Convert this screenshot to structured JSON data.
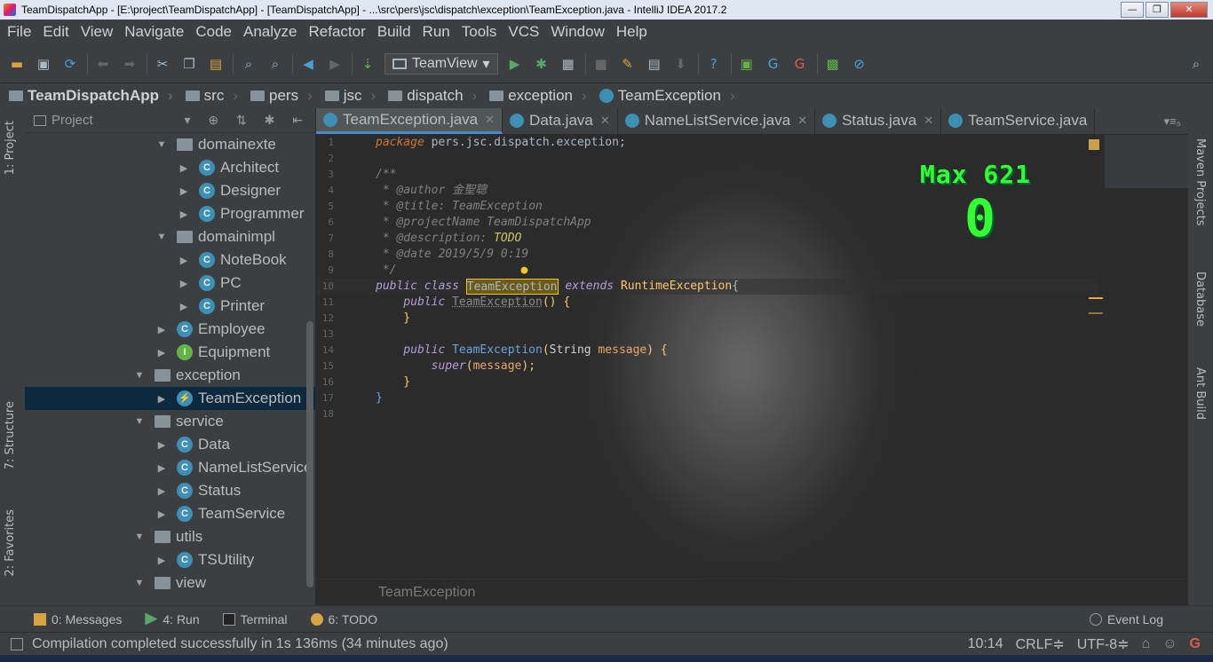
{
  "window": {
    "title": "TeamDispatchApp - [E:\\project\\TeamDispatchApp] - [TeamDispatchApp] - ...\\src\\pers\\jsc\\dispatch\\exception\\TeamException.java - IntelliJ IDEA 2017.2",
    "minimize": "—",
    "maximize": "❐",
    "close": "✕"
  },
  "menu": [
    "File",
    "Edit",
    "View",
    "Navigate",
    "Code",
    "Analyze",
    "Refactor",
    "Build",
    "Run",
    "Tools",
    "VCS",
    "Window",
    "Help"
  ],
  "toolbar": {
    "run_config": "TeamView",
    "run_config_arrow": "▾"
  },
  "breadcrumb": {
    "project": "TeamDispatchApp",
    "items": [
      "src",
      "pers",
      "jsc",
      "dispatch",
      "exception"
    ],
    "current": "TeamException"
  },
  "side_tabs": {
    "project": "1: Project",
    "structure": "7: Structure",
    "favorites": "2: Favorites",
    "maven": "Maven Projects",
    "database": "Database",
    "ant": "Ant Build"
  },
  "project_panel": {
    "title": "Project",
    "tools": "▾ ⊕ ⇅ ✱ ⇤",
    "tree": [
      {
        "label": "domainexte",
        "type": "package",
        "indent": 1,
        "arrow": "▼"
      },
      {
        "label": "Architect",
        "type": "class",
        "indent": 2,
        "arrow": "▶"
      },
      {
        "label": "Designer",
        "type": "class",
        "indent": 2,
        "arrow": "▶"
      },
      {
        "label": "Programmer",
        "type": "class",
        "indent": 2,
        "arrow": "▶"
      },
      {
        "label": "domainimpl",
        "type": "package",
        "indent": 1,
        "arrow": "▼"
      },
      {
        "label": "NoteBook",
        "type": "class",
        "indent": 2,
        "arrow": "▶"
      },
      {
        "label": "PC",
        "type": "class",
        "indent": 2,
        "arrow": "▶"
      },
      {
        "label": "Printer",
        "type": "class",
        "indent": 2,
        "arrow": "▶"
      },
      {
        "label": "Employee",
        "type": "class",
        "indent": 1,
        "arrow": "▶"
      },
      {
        "label": "Equipment",
        "type": "interface",
        "indent": 1,
        "arrow": "▶"
      },
      {
        "label": "exception",
        "type": "package",
        "indent": 0,
        "arrow": "▼"
      },
      {
        "label": "TeamException",
        "type": "exception",
        "indent": 1,
        "arrow": "▶",
        "selected": true
      },
      {
        "label": "service",
        "type": "package",
        "indent": 0,
        "arrow": "▼"
      },
      {
        "label": "Data",
        "type": "class",
        "indent": 1,
        "arrow": "▶"
      },
      {
        "label": "NameListService",
        "type": "class",
        "indent": 1,
        "arrow": "▶"
      },
      {
        "label": "Status",
        "type": "class",
        "indent": 1,
        "arrow": "▶"
      },
      {
        "label": "TeamService",
        "type": "class",
        "indent": 1,
        "arrow": "▶"
      },
      {
        "label": "utils",
        "type": "package",
        "indent": 0,
        "arrow": "▼"
      },
      {
        "label": "TSUtility",
        "type": "class",
        "indent": 1,
        "arrow": "▶"
      },
      {
        "label": "view",
        "type": "package",
        "indent": 0,
        "arrow": "▼"
      }
    ]
  },
  "tabs": [
    {
      "label": "TeamException.java",
      "active": true
    },
    {
      "label": "Data.java",
      "active": false
    },
    {
      "label": "NameListService.java",
      "active": false
    },
    {
      "label": "Status.java",
      "active": false
    },
    {
      "label": "TeamService.java",
      "active": false
    }
  ],
  "tabs_more": "▾≡₅",
  "code": {
    "package": "pers.jsc.dispatch.exception;",
    "author_tag": "@author",
    "author": "金聖聰",
    "title_tag": "@title:",
    "title": "TeamException",
    "project_tag": "@projectName",
    "project": "TeamDispatchApp",
    "desc_tag": "@description:",
    "desc": "TODO",
    "date_tag": "@date",
    "date": "2019/5/9 0:19",
    "class_name": "TeamException",
    "super_class": "RuntimeException",
    "ctor_param": "message",
    "param_type": "String"
  },
  "game_overlay": {
    "max_label": "Max 621",
    "current": "0"
  },
  "editor_footer": "TeamException",
  "tool_windows": [
    {
      "label": "0: Messages"
    },
    {
      "label": "4: Run"
    },
    {
      "label": "Terminal"
    },
    {
      "label": "6: TODO"
    }
  ],
  "event_log": "Event Log",
  "status": {
    "message": "Compilation completed successfully in 1s 136ms (34 minutes ago)",
    "position": "10:14",
    "line_sep": "CRLF≑",
    "encoding": "UTF-8≑"
  },
  "colors": {
    "accent": "#4a88c7",
    "game_green": "#33ff33"
  }
}
